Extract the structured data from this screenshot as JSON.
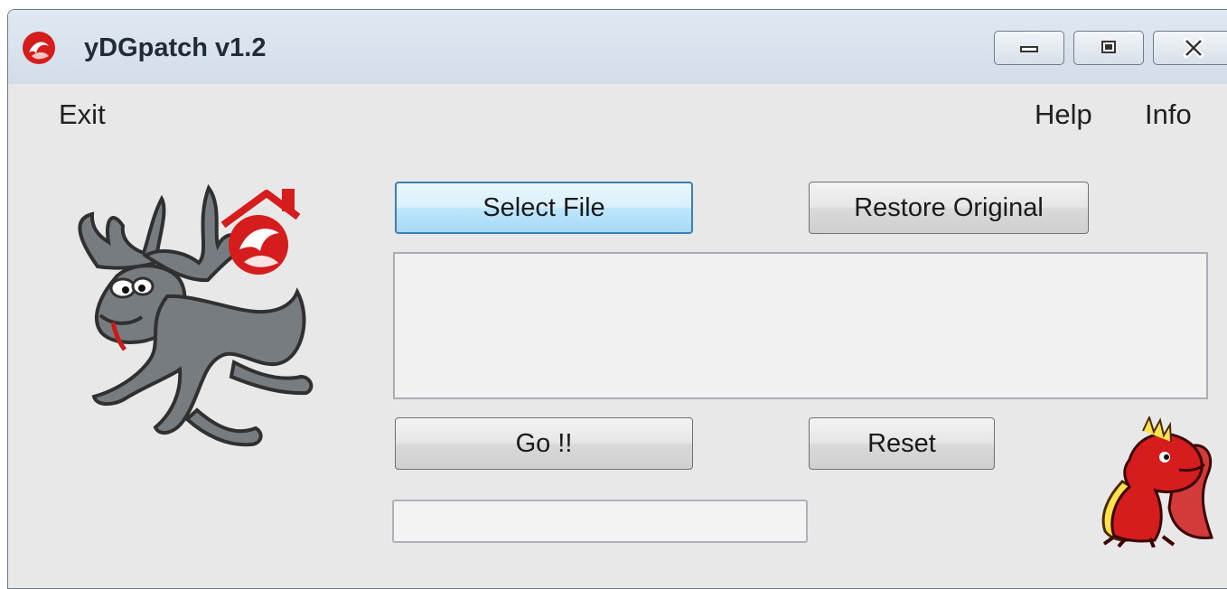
{
  "window": {
    "title": "yDGpatch v1.2",
    "controls": {
      "minimize_icon": "minimize-icon",
      "maximize_icon": "maximize-icon",
      "close_icon": "close-icon"
    }
  },
  "menu": {
    "exit": "Exit",
    "help": "Help",
    "info": "Info"
  },
  "buttons": {
    "select_file": "Select File",
    "restore_original": "Restore Original",
    "go": "Go !!",
    "reset": "Reset"
  },
  "icons": {
    "app": "red-circle-icon",
    "moose": "moose-icon",
    "home": "red-home-icon",
    "dragon": "red-dragon-icon"
  },
  "colors": {
    "titlebar": "#d8e3ee",
    "window_background": "#e8e8e8",
    "focused_button_border": "#3c7fb1",
    "red_accent": "#d51d1d"
  }
}
